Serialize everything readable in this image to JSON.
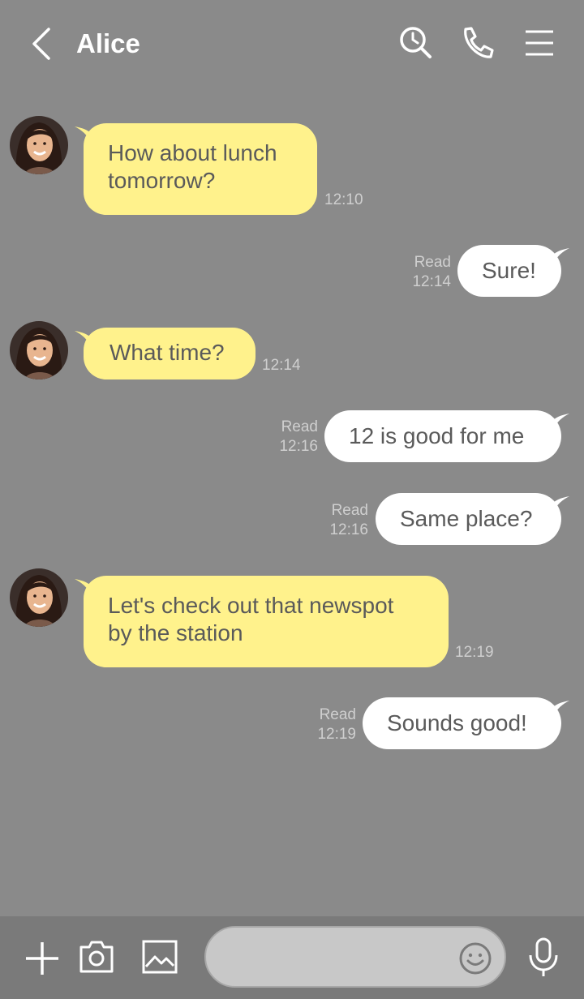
{
  "header": {
    "title": "Alice",
    "back_icon": "chevron-left-icon",
    "search_icon": "search-history-icon",
    "call_icon": "phone-icon",
    "menu_icon": "hamburger-menu-icon"
  },
  "messages": [
    {
      "direction": "in",
      "line1": "How about lunch",
      "line2": "tomorrow?",
      "time": "12:10"
    },
    {
      "direction": "out",
      "text": "Sure!",
      "read": "Read",
      "time": "12:14"
    },
    {
      "direction": "in",
      "text": "What time?",
      "time": "12:14"
    },
    {
      "direction": "out",
      "text": "12 is good for me",
      "read": "Read",
      "time": "12:16"
    },
    {
      "direction": "out",
      "text": "Same place?",
      "read": "Read",
      "time": "12:16"
    },
    {
      "direction": "in",
      "line1": "Let's check out that newspot",
      "line2": "by the station",
      "time": "12:19"
    },
    {
      "direction": "out",
      "text": "Sounds good!",
      "read": "Read",
      "time": "12:19"
    }
  ],
  "composer": {
    "placeholder": "",
    "plus_icon": "plus-icon",
    "camera_icon": "camera-icon",
    "gallery_icon": "image-icon",
    "emoji_icon": "emoji-icon",
    "mic_icon": "microphone-icon"
  },
  "colors": {
    "background": "#8a8a8a",
    "incoming_bubble": "#fff28c",
    "outgoing_bubble": "#ffffff",
    "text": "#5a5a5a",
    "meta": "#cfcfcf",
    "bottom_bar": "#7a7a7a"
  }
}
